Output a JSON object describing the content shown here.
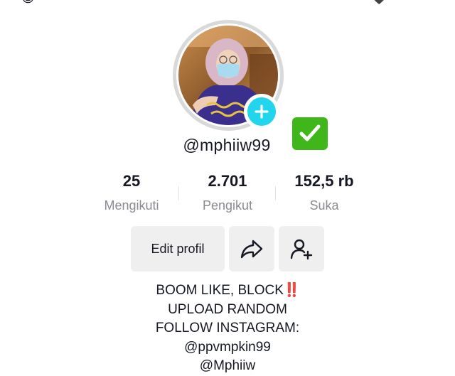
{
  "profile": {
    "username": "@mphiiw99",
    "verified_badge_icon": "check-mark-button-emoji"
  },
  "stats": [
    {
      "value": "25",
      "label": "Mengikuti"
    },
    {
      "value": "2.701",
      "label": "Pengikut"
    },
    {
      "value": "152,5 rb",
      "label": "Suka"
    }
  ],
  "actions": {
    "edit_label": "Edit profil",
    "share_icon": "share-arrow-icon",
    "add_friend_icon": "add-user-icon"
  },
  "bio": {
    "line1": "BOOM LIKE, BLOCK",
    "line1_emoji": "‼️",
    "line2": "UPLOAD RANDOM",
    "line3": "FOLLOW INSTAGRAM:",
    "line4": "@ppvmpkin99",
    "line5": "@Mphiiw"
  },
  "colors": {
    "text": "#161823",
    "muted": "#8a8b91",
    "button_bg": "#efefef",
    "plus_badge": "#20d5ec",
    "verified_green": "#3fb619"
  }
}
